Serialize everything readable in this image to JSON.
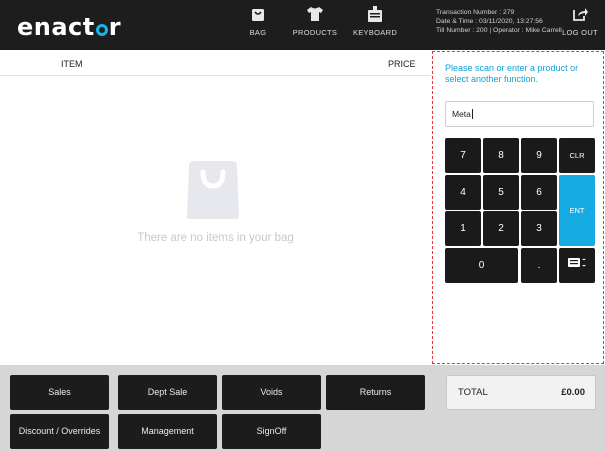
{
  "app": {
    "logo_text_left": "enact",
    "logo_text_right": "r"
  },
  "nav": {
    "bag": {
      "label": "BAG",
      "icon": "bag-icon"
    },
    "products": {
      "label": "PRODUCTS",
      "icon": "tshirt-icon"
    },
    "keyboard": {
      "label": "KEYBOARD",
      "icon": "keyboard-icon"
    },
    "logout": {
      "label": "LOG OUT",
      "icon": "logout-icon"
    }
  },
  "transaction": {
    "line1": "Transaction Number : 279",
    "line2": "Date & Time : 03/11/2020, 13:27:56",
    "line3": "Till Number : 200  |  Operator : Mike Carrell"
  },
  "items": {
    "col_item": "ITEM",
    "col_price": "PRICE",
    "empty_message": "There are no items in your bag"
  },
  "entry": {
    "prompt": "Please scan or enter a product or select another function.",
    "value": "Meta"
  },
  "keypad": {
    "k7": "7",
    "k8": "8",
    "k9": "9",
    "clr": "CLR",
    "k4": "4",
    "k5": "5",
    "k6": "6",
    "ent": "ENT",
    "k1": "1",
    "k2": "2",
    "k3": "3",
    "k0": "0",
    "dot": "."
  },
  "functions": {
    "sales": "Sales",
    "dept_sale": "Dept Sale",
    "voids": "Voids",
    "returns": "Returns",
    "discount": "Discount / Overrides",
    "management": "Management",
    "signoff": "SignOff"
  },
  "total": {
    "label": "TOTAL",
    "value": "£0.00"
  },
  "colors": {
    "accent": "#13b5ea",
    "highlight_border": "#e53935",
    "topbar": "#1d1d1d"
  }
}
